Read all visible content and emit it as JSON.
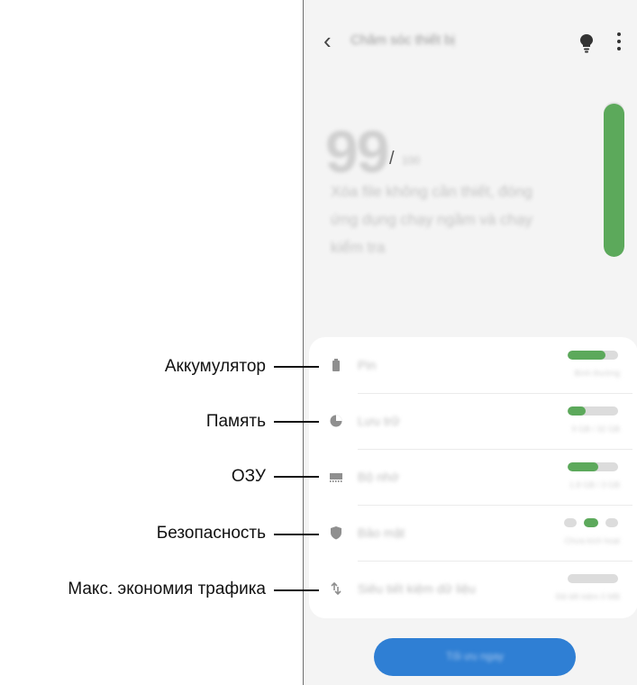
{
  "header": {
    "back_icon": "chevron-left-icon",
    "title": "Chăm sóc thiết bị",
    "tips_icon": "lightbulb-icon",
    "more_icon": "more-vertical-icon"
  },
  "score": {
    "value": "99",
    "separator": "/",
    "max": "100",
    "level": 0.99,
    "description": "Xóa file không cần thiết, đóng ứng dụng chạy ngầm và chạy kiểm tra",
    "color": "#5ca95b"
  },
  "items": [
    {
      "key": "battery",
      "icon": "battery-icon",
      "label": "Pin",
      "status": "Bình thường",
      "level": 0.75
    },
    {
      "key": "storage",
      "icon": "storage-icon",
      "label": "Lưu trữ",
      "status": "9 GB / 32 GB",
      "level": 0.35
    },
    {
      "key": "memory",
      "icon": "memory-icon",
      "label": "Bộ nhớ",
      "status": "1.8 GB / 3 GB",
      "level": 0.6
    },
    {
      "key": "security",
      "icon": "shield-icon",
      "label": "Bảo mật",
      "status": "Chưa kích hoạt",
      "active_step": 1
    },
    {
      "key": "data-saver",
      "icon": "data-saver-icon",
      "label": "Siêu tiết kiệm dữ liệu",
      "status": "Đã tiết kiệm 0 MB",
      "level": 0
    }
  ],
  "main_button": {
    "label": "Tối ưu ngay"
  },
  "callouts": [
    "Аккумулятор",
    "Память",
    "ОЗУ",
    "Безопасность",
    "Макс. экономия трафика"
  ],
  "colors": {
    "accent_green": "#5ca95b",
    "button_blue": "#2f7fd4"
  }
}
